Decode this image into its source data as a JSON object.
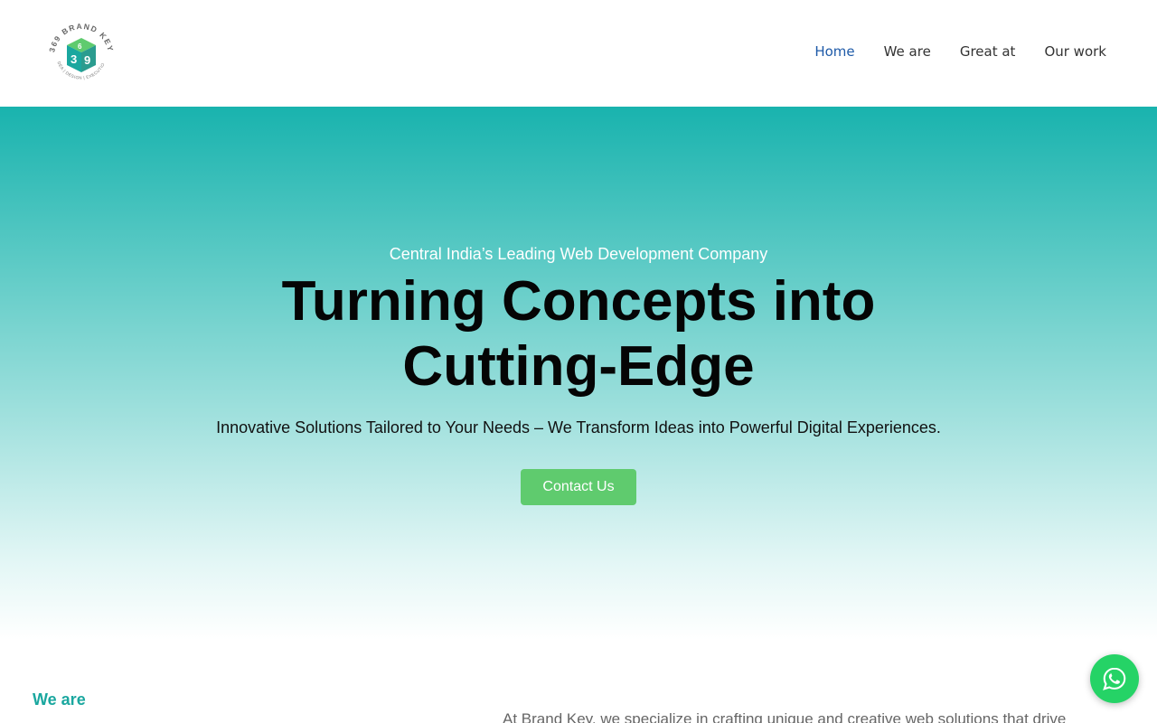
{
  "brand": {
    "logo_ring_text": "369 BRAND KEY",
    "logo_tagline": "IDEA | DESIGN | EXECUTION",
    "logo_colors": [
      "#1aa79f",
      "#5fcb6e",
      "#2b9c8f"
    ]
  },
  "nav": {
    "items": [
      {
        "label": "Home",
        "active": true
      },
      {
        "label": "We are",
        "active": false
      },
      {
        "label": "Great at",
        "active": false
      },
      {
        "label": "Our work",
        "active": false
      }
    ],
    "active_color": "#1e5aa8"
  },
  "hero": {
    "eyebrow": "Central India’s Leading Web Development Company",
    "title_line1": "Turning Concepts into",
    "title_line2": "Cutting-Edge",
    "subtitle": "Innovative Solutions Tailored to Your Needs – We Transform Ideas into Powerful Digital Experiences.",
    "cta_label": "Contact Us",
    "gradient_top": "#19b3ae",
    "cta_color": "#5fcb6e"
  },
  "about": {
    "label": "We are",
    "text": "At Brand Key, we specialize in crafting unique and creative web solutions that drive"
  },
  "whatsapp": {
    "icon": "whatsapp-icon",
    "color": "#25d366"
  }
}
